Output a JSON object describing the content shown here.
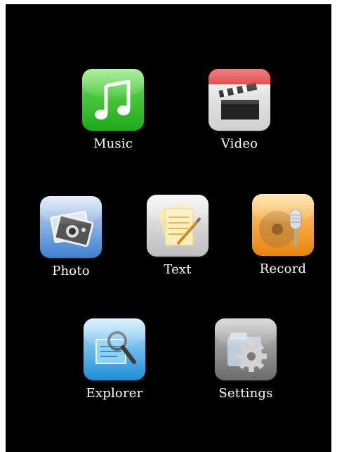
{
  "apps": [
    {
      "label": "Music",
      "icon": "music-note-icon",
      "color": "#3ec11f"
    },
    {
      "label": "Video",
      "icon": "clapperboard-icon",
      "color": "#e41c1c"
    },
    {
      "label": "Photo",
      "icon": "camera-photo-icon",
      "color": "#3a78c9"
    },
    {
      "label": "Text",
      "icon": "notepad-pencil-icon",
      "color": "#d9d6cf"
    },
    {
      "label": "Record",
      "icon": "microphone-icon",
      "color": "#f0a11d"
    },
    {
      "label": "Explorer",
      "icon": "magnifier-document-icon",
      "color": "#2fa3e6"
    },
    {
      "label": "Settings",
      "icon": "gear-folder-icon",
      "color": "#8a8a8a"
    }
  ]
}
